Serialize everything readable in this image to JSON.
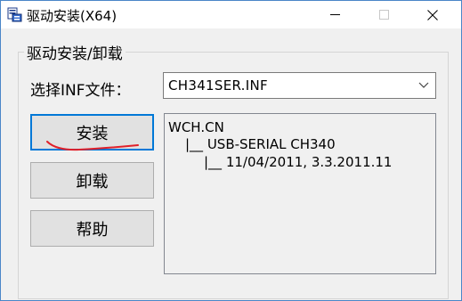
{
  "window": {
    "title": "驱动安装(X64)",
    "icon": "driver-setup-icon"
  },
  "caption_buttons": {
    "minimize": "—",
    "maximize": "□",
    "close": "✕"
  },
  "group": {
    "label": "驱动安装/卸载"
  },
  "inf_select": {
    "label": "选择INF文件：",
    "value": "CH341SER.INF"
  },
  "buttons": {
    "install": "安装",
    "uninstall": "卸载",
    "help": "帮助"
  },
  "info": {
    "lines": [
      "WCH.CN",
      "|__ USB-SERIAL CH340",
      "|__ 11/04/2011, 3.3.2011.11"
    ]
  },
  "colors": {
    "annotation_mark": "#e0202a",
    "focus_border": "#0078d7"
  }
}
